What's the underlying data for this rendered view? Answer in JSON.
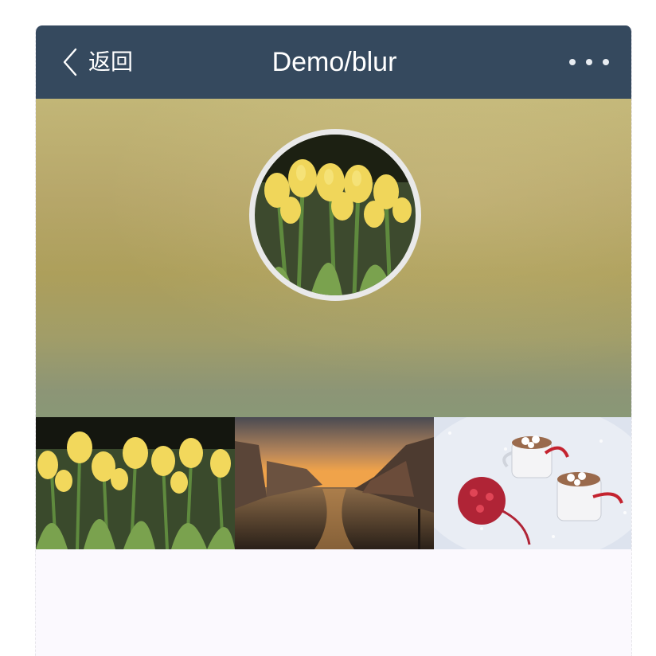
{
  "navbar": {
    "back_label": "返回",
    "title": "Demo/blur",
    "more_icon": "more-dots-icon",
    "background": "#35495e"
  },
  "hero": {
    "avatar_image": "tulips",
    "gradient_colors": [
      "#c2b677",
      "#ad9f5b",
      "#899876"
    ]
  },
  "gallery": {
    "images": [
      "tulips",
      "canal-sunset",
      "hot-cocoa-winter"
    ]
  }
}
